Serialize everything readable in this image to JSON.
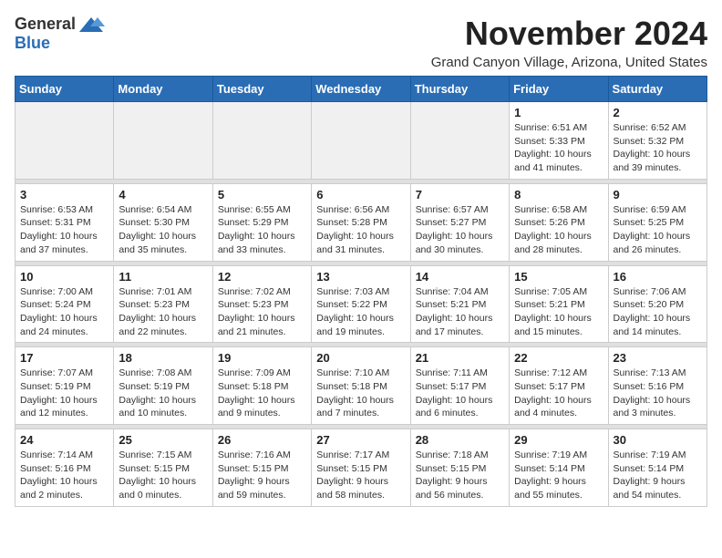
{
  "logo": {
    "general": "General",
    "blue": "Blue"
  },
  "header": {
    "month": "November 2024",
    "location": "Grand Canyon Village, Arizona, United States"
  },
  "weekdays": [
    "Sunday",
    "Monday",
    "Tuesday",
    "Wednesday",
    "Thursday",
    "Friday",
    "Saturday"
  ],
  "weeks": [
    [
      {
        "day": "",
        "info": ""
      },
      {
        "day": "",
        "info": ""
      },
      {
        "day": "",
        "info": ""
      },
      {
        "day": "",
        "info": ""
      },
      {
        "day": "",
        "info": ""
      },
      {
        "day": "1",
        "info": "Sunrise: 6:51 AM\nSunset: 5:33 PM\nDaylight: 10 hours\nand 41 minutes."
      },
      {
        "day": "2",
        "info": "Sunrise: 6:52 AM\nSunset: 5:32 PM\nDaylight: 10 hours\nand 39 minutes."
      }
    ],
    [
      {
        "day": "3",
        "info": "Sunrise: 6:53 AM\nSunset: 5:31 PM\nDaylight: 10 hours\nand 37 minutes."
      },
      {
        "day": "4",
        "info": "Sunrise: 6:54 AM\nSunset: 5:30 PM\nDaylight: 10 hours\nand 35 minutes."
      },
      {
        "day": "5",
        "info": "Sunrise: 6:55 AM\nSunset: 5:29 PM\nDaylight: 10 hours\nand 33 minutes."
      },
      {
        "day": "6",
        "info": "Sunrise: 6:56 AM\nSunset: 5:28 PM\nDaylight: 10 hours\nand 31 minutes."
      },
      {
        "day": "7",
        "info": "Sunrise: 6:57 AM\nSunset: 5:27 PM\nDaylight: 10 hours\nand 30 minutes."
      },
      {
        "day": "8",
        "info": "Sunrise: 6:58 AM\nSunset: 5:26 PM\nDaylight: 10 hours\nand 28 minutes."
      },
      {
        "day": "9",
        "info": "Sunrise: 6:59 AM\nSunset: 5:25 PM\nDaylight: 10 hours\nand 26 minutes."
      }
    ],
    [
      {
        "day": "10",
        "info": "Sunrise: 7:00 AM\nSunset: 5:24 PM\nDaylight: 10 hours\nand 24 minutes."
      },
      {
        "day": "11",
        "info": "Sunrise: 7:01 AM\nSunset: 5:23 PM\nDaylight: 10 hours\nand 22 minutes."
      },
      {
        "day": "12",
        "info": "Sunrise: 7:02 AM\nSunset: 5:23 PM\nDaylight: 10 hours\nand 21 minutes."
      },
      {
        "day": "13",
        "info": "Sunrise: 7:03 AM\nSunset: 5:22 PM\nDaylight: 10 hours\nand 19 minutes."
      },
      {
        "day": "14",
        "info": "Sunrise: 7:04 AM\nSunset: 5:21 PM\nDaylight: 10 hours\nand 17 minutes."
      },
      {
        "day": "15",
        "info": "Sunrise: 7:05 AM\nSunset: 5:21 PM\nDaylight: 10 hours\nand 15 minutes."
      },
      {
        "day": "16",
        "info": "Sunrise: 7:06 AM\nSunset: 5:20 PM\nDaylight: 10 hours\nand 14 minutes."
      }
    ],
    [
      {
        "day": "17",
        "info": "Sunrise: 7:07 AM\nSunset: 5:19 PM\nDaylight: 10 hours\nand 12 minutes."
      },
      {
        "day": "18",
        "info": "Sunrise: 7:08 AM\nSunset: 5:19 PM\nDaylight: 10 hours\nand 10 minutes."
      },
      {
        "day": "19",
        "info": "Sunrise: 7:09 AM\nSunset: 5:18 PM\nDaylight: 10 hours\nand 9 minutes."
      },
      {
        "day": "20",
        "info": "Sunrise: 7:10 AM\nSunset: 5:18 PM\nDaylight: 10 hours\nand 7 minutes."
      },
      {
        "day": "21",
        "info": "Sunrise: 7:11 AM\nSunset: 5:17 PM\nDaylight: 10 hours\nand 6 minutes."
      },
      {
        "day": "22",
        "info": "Sunrise: 7:12 AM\nSunset: 5:17 PM\nDaylight: 10 hours\nand 4 minutes."
      },
      {
        "day": "23",
        "info": "Sunrise: 7:13 AM\nSunset: 5:16 PM\nDaylight: 10 hours\nand 3 minutes."
      }
    ],
    [
      {
        "day": "24",
        "info": "Sunrise: 7:14 AM\nSunset: 5:16 PM\nDaylight: 10 hours\nand 2 minutes."
      },
      {
        "day": "25",
        "info": "Sunrise: 7:15 AM\nSunset: 5:15 PM\nDaylight: 10 hours\nand 0 minutes."
      },
      {
        "day": "26",
        "info": "Sunrise: 7:16 AM\nSunset: 5:15 PM\nDaylight: 9 hours\nand 59 minutes."
      },
      {
        "day": "27",
        "info": "Sunrise: 7:17 AM\nSunset: 5:15 PM\nDaylight: 9 hours\nand 58 minutes."
      },
      {
        "day": "28",
        "info": "Sunrise: 7:18 AM\nSunset: 5:15 PM\nDaylight: 9 hours\nand 56 minutes."
      },
      {
        "day": "29",
        "info": "Sunrise: 7:19 AM\nSunset: 5:14 PM\nDaylight: 9 hours\nand 55 minutes."
      },
      {
        "day": "30",
        "info": "Sunrise: 7:19 AM\nSunset: 5:14 PM\nDaylight: 9 hours\nand 54 minutes."
      }
    ]
  ]
}
